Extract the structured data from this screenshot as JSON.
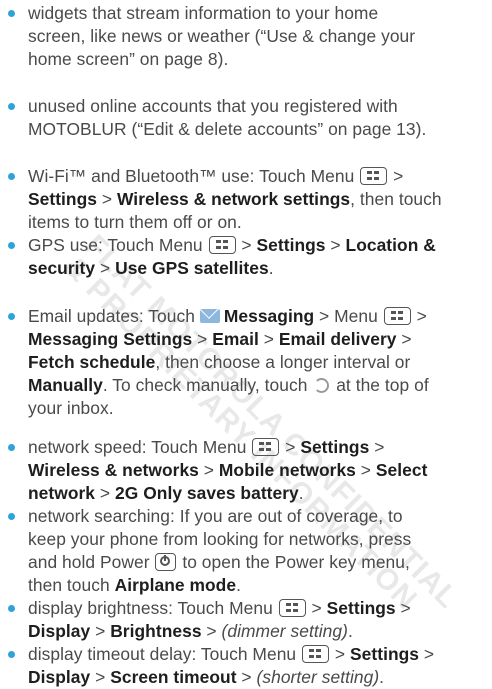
{
  "watermark": {
    "line1": "FLAT MOTOROLA CONFIDENTIAL",
    "line2": "& PROPRIETARY INFORMATION"
  },
  "icons": {
    "menu": "menu-key-icon",
    "messaging": "messaging-envelope-icon",
    "sync": "sync-arrows-icon",
    "power": "power-key-icon"
  },
  "colors": {
    "bullet": "#2ea3da",
    "text": "#4a4a4a",
    "bold": "#1e1e1e"
  },
  "items": [
    {
      "lines": [
        [
          {
            "t": "widgets that stream information to your home"
          }
        ],
        [
          {
            "t": "screen, like news or weather (“Use & change your"
          }
        ],
        [
          {
            "t": "home screen” on page 8)."
          }
        ]
      ]
    },
    {
      "lines": [
        [
          {
            "t": "unused online accounts that you registered with"
          }
        ],
        [
          {
            "t": "MOTOBLUR (“Edit & delete accounts” on page 13)."
          }
        ]
      ]
    },
    {
      "lines": [
        [
          {
            "t": "Wi-Fi™ and Bluetooth™ use: Touch Menu "
          },
          {
            "icon": "menu"
          },
          {
            "t": " >"
          }
        ],
        [
          {
            "t": "Settings",
            "b": 1
          },
          {
            "t": " > "
          },
          {
            "t": "Wireless & network settings",
            "b": 1
          },
          {
            "t": ", then touch"
          }
        ],
        [
          {
            "t": "items to turn them off or on."
          }
        ]
      ]
    },
    {
      "lines": [
        [
          {
            "t": "GPS use: Touch Menu "
          },
          {
            "icon": "menu"
          },
          {
            "t": " > "
          },
          {
            "t": "Settings",
            "b": 1
          },
          {
            "t": " > "
          },
          {
            "t": "Location &",
            "b": 1
          }
        ],
        [
          {
            "t": "security",
            "b": 1
          },
          {
            "t": " > "
          },
          {
            "t": "Use GPS satellites",
            "b": 1
          },
          {
            "t": "."
          }
        ]
      ]
    },
    {
      "lines": [
        [
          {
            "t": "Email updates: Touch "
          },
          {
            "icon": "messaging"
          },
          {
            "t": "Messaging",
            "b": 1
          },
          {
            "t": " > Menu "
          },
          {
            "icon": "menu"
          },
          {
            "t": " >"
          }
        ],
        [
          {
            "t": "Messaging Settings",
            "b": 1
          },
          {
            "t": " > "
          },
          {
            "t": "Email",
            "b": 1
          },
          {
            "t": " > "
          },
          {
            "t": "Email delivery",
            "b": 1
          },
          {
            "t": " >"
          }
        ],
        [
          {
            "t": "Fetch schedule",
            "b": 1
          },
          {
            "t": ", then choose a longer interval or"
          }
        ],
        [
          {
            "t": "Manually",
            "b": 1
          },
          {
            "t": ". To check manually, touch "
          },
          {
            "icon": "sync"
          },
          {
            "t": " at the top of"
          }
        ],
        [
          {
            "t": "your inbox."
          }
        ]
      ]
    },
    {
      "lines": [
        [
          {
            "t": "network speed: Touch Menu "
          },
          {
            "icon": "menu"
          },
          {
            "t": " > "
          },
          {
            "t": "Settings",
            "b": 1
          },
          {
            "t": " >"
          }
        ],
        [
          {
            "t": "Wireless & networks",
            "b": 1
          },
          {
            "t": " > "
          },
          {
            "t": "Mobile networks",
            "b": 1
          },
          {
            "t": " > "
          },
          {
            "t": "Select",
            "b": 1
          }
        ],
        [
          {
            "t": "network",
            "b": 1
          },
          {
            "t": " > "
          },
          {
            "t": "2G Only saves battery",
            "b": 1
          },
          {
            "t": "."
          }
        ]
      ]
    },
    {
      "lines": [
        [
          {
            "t": "network searching: If you are out of coverage, to"
          }
        ],
        [
          {
            "t": "keep your phone from looking for networks, press"
          }
        ],
        [
          {
            "t": "and hold Power "
          },
          {
            "icon": "power"
          },
          {
            "t": " to open the Power key menu,"
          }
        ],
        [
          {
            "t": "then touch "
          },
          {
            "t": "Airplane mode",
            "b": 1
          },
          {
            "t": "."
          }
        ]
      ]
    },
    {
      "lines": [
        [
          {
            "t": "display brightness: Touch Menu "
          },
          {
            "icon": "menu"
          },
          {
            "t": " > "
          },
          {
            "t": "Settings",
            "b": 1
          },
          {
            "t": " >"
          }
        ],
        [
          {
            "t": "Display",
            "b": 1
          },
          {
            "t": " > "
          },
          {
            "t": "Brightness",
            "b": 1
          },
          {
            "t": " > "
          },
          {
            "t": "(dimmer setting)",
            "i": 1
          },
          {
            "t": "."
          }
        ]
      ]
    },
    {
      "lines": [
        [
          {
            "t": "display timeout delay: Touch Menu "
          },
          {
            "icon": "menu"
          },
          {
            "t": " > "
          },
          {
            "t": "Settings",
            "b": 1
          },
          {
            "t": " >"
          }
        ],
        [
          {
            "t": "Display",
            "b": 1
          },
          {
            "t": " > "
          },
          {
            "t": "Screen timeout",
            "b": 1
          },
          {
            "t": " > "
          },
          {
            "t": "(shorter setting)",
            "i": 1
          },
          {
            "t": "."
          }
        ]
      ]
    }
  ]
}
